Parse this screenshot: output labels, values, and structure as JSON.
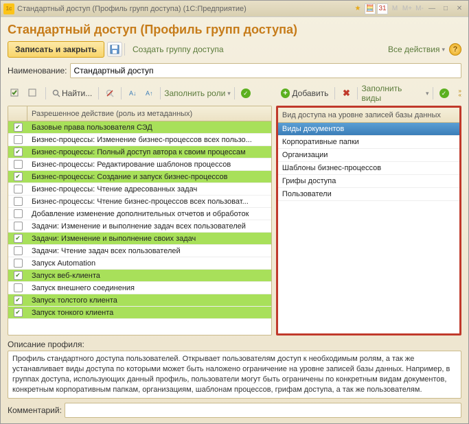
{
  "titlebar": {
    "text": "Стандартный доступ (Профиль групп доступа) (1С:Предприятие)"
  },
  "main_title": "Стандартный доступ (Профиль групп доступа)",
  "actions": {
    "save_close": "Записать и закрыть",
    "create_group": "Создать группу доступа",
    "all_actions": "Все действия"
  },
  "name_field": {
    "label": "Наименование:",
    "value": "Стандартный доступ"
  },
  "left_toolbar": {
    "find": "Найти...",
    "fill_roles": "Заполнить роли"
  },
  "right_toolbar": {
    "add": "Добавить",
    "fill_types": "Заполнить виды"
  },
  "left_grid": {
    "header": "Разрешенное действие (роль из метаданных)",
    "rows": [
      {
        "checked": true,
        "hl": true,
        "text": "Базовые права пользователя СЭД"
      },
      {
        "checked": false,
        "hl": false,
        "text": "Бизнес-процессы: Изменение бизнес-процессов всех пользо..."
      },
      {
        "checked": true,
        "hl": true,
        "text": "Бизнес-процессы: Полный доступ автора к своим процессам"
      },
      {
        "checked": false,
        "hl": false,
        "text": "Бизнес-процессы: Редактирование шаблонов процессов"
      },
      {
        "checked": true,
        "hl": true,
        "text": "Бизнес-процессы: Создание и запуск бизнес-процессов"
      },
      {
        "checked": false,
        "hl": false,
        "text": "Бизнес-процессы: Чтение адресованных задач"
      },
      {
        "checked": false,
        "hl": false,
        "text": "Бизнес-процессы: Чтение бизнес-процессов всех пользоват..."
      },
      {
        "checked": false,
        "hl": false,
        "text": "Добавление изменение дополнительных отчетов и обработок"
      },
      {
        "checked": false,
        "hl": false,
        "text": "Задачи: Изменение и выполнение задач всех пользователей"
      },
      {
        "checked": true,
        "hl": true,
        "text": "Задачи: Изменение и выполнение своих задач"
      },
      {
        "checked": false,
        "hl": false,
        "text": "Задачи: Чтение задач всех пользователей"
      },
      {
        "checked": false,
        "hl": false,
        "text": "Запуск Automation"
      },
      {
        "checked": true,
        "hl": true,
        "text": "Запуск веб-клиента"
      },
      {
        "checked": false,
        "hl": false,
        "text": "Запуск внешнего соединения"
      },
      {
        "checked": true,
        "hl": true,
        "text": "Запуск толстого клиента"
      },
      {
        "checked": true,
        "hl": true,
        "text": "Запуск тонкого клиента"
      }
    ]
  },
  "right_grid": {
    "header": "Вид доступа на уровне записей базы данных",
    "rows": [
      {
        "sel": true,
        "text": "Виды документов"
      },
      {
        "sel": false,
        "text": "Корпоративные папки"
      },
      {
        "sel": false,
        "text": "Организации"
      },
      {
        "sel": false,
        "text": "Шаблоны бизнес-процессов"
      },
      {
        "sel": false,
        "text": "Грифы доступа"
      },
      {
        "sel": false,
        "text": "Пользователи"
      }
    ]
  },
  "description": {
    "label": "Описание профиля:",
    "text": "Профиль стандартного доступа пользователей. Открывает пользователям доступ к необходимым ролям, а так же устанавливает виды доступа по которыми может быть наложено ограничение на уровне записей базы данных. Например, в группах доступа, использующих данный профиль, пользователи могут быть ограничены по конкретным видам документов, конкретным корпоративным папкам, организациям, шаблонам процессов, грифам доступа, а так же пользователям."
  },
  "comment": {
    "label": "Комментарий:",
    "value": ""
  }
}
